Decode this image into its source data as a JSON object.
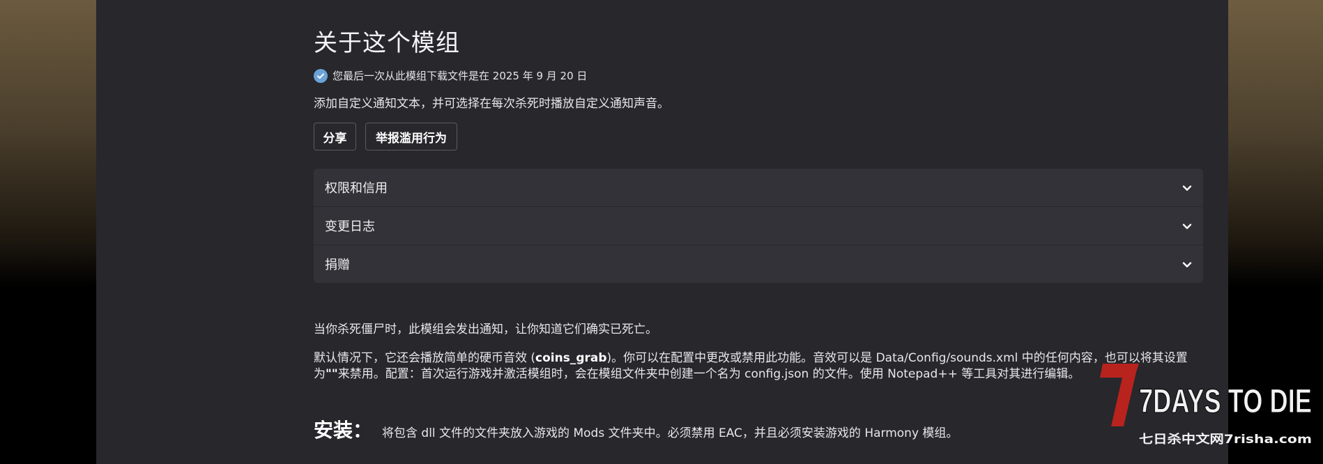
{
  "header": {
    "title": "关于这个模组"
  },
  "download_info": {
    "text": "您最后一次从此模组下载文件是在 2025 年 9 月 20 日"
  },
  "summary": "添加自定义通知文本，并可选择在每次杀死时播放自定义通知声音。",
  "buttons": {
    "share": "分享",
    "report": "举报滥用行为"
  },
  "accordion": [
    {
      "label": "权限和信用"
    },
    {
      "label": "变更日志"
    },
    {
      "label": "捐赠"
    }
  ],
  "description": {
    "para1": "当你杀死僵尸时，此模组会发出通知，让你知道它们确实已死亡。",
    "para2_a": "默认情况下，它还会播放简单的硬币音效 (",
    "para2_code": "coins_grab",
    "para2_b": ")。你可以在配置中更改或禁用此功能。音效可以是 Data/Config/sounds.xml 中的任何内容，也可以将其设置为",
    "para2_quote": "\"\"",
    "para2_c": "来禁用。配置：首次运行游戏并激活模组时，会在模组文件夹中创建一个名为 config.json 的文件。使用 Notepad++ 等工具对其进行编辑。"
  },
  "install": {
    "label": "安装：",
    "text": "将包含 dll 文件的文件夹放入游戏的 Mods 文件夹中。必须禁用 EAC，并且必须安装游戏的 Harmony 模组。"
  },
  "watermark": {
    "logo_text": "7DAYS TO DIE",
    "site": "七日杀中文网7risha.com"
  },
  "colors": {
    "panel": "#27272c",
    "accordion": "#323238",
    "check": "#6ba3d6",
    "logo_red": "#b8231e"
  },
  "icons": {
    "check": "check-circle-icon",
    "chevron": "chevron-down-icon"
  }
}
